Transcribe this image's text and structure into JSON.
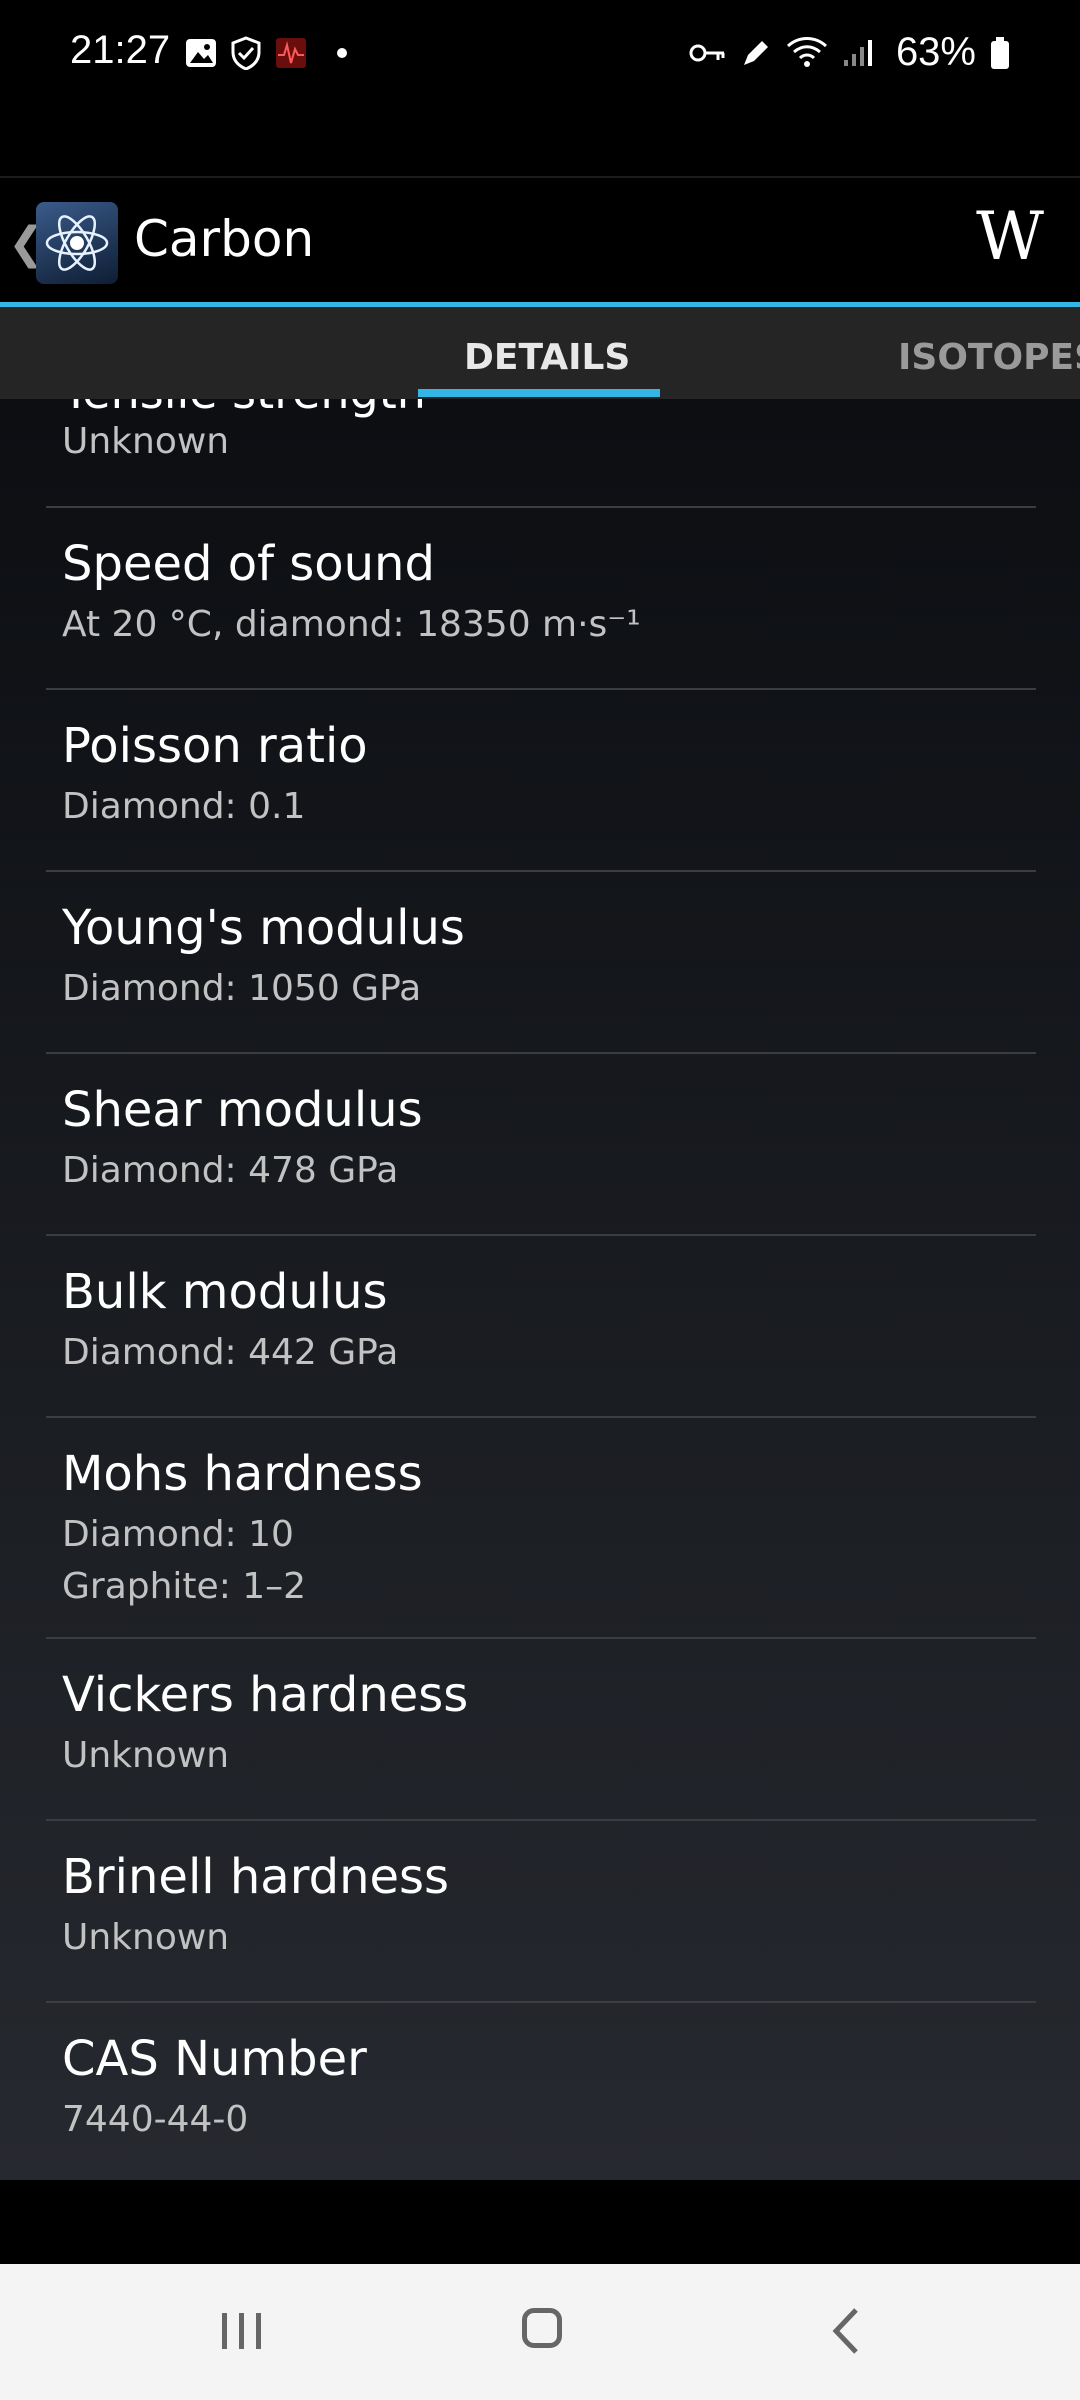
{
  "status_bar": {
    "time": "21:27",
    "battery": "63%",
    "icons_left": [
      "gallery-icon",
      "shield-icon",
      "pulse-icon",
      "notification-dot"
    ],
    "icons_right": [
      "vpn-key-icon",
      "pen-icon",
      "wifi-icon",
      "signal-icon",
      "battery-icon"
    ]
  },
  "action_bar": {
    "back": "❮",
    "title": "Carbon",
    "wiki": "W"
  },
  "tabs": [
    {
      "label": "DETAILS",
      "selected": true
    },
    {
      "label": "ISOTOPES",
      "selected": false
    }
  ],
  "accent_color": "#33b5e5",
  "partial_item": {
    "title": "Tensile strength",
    "value": "Unknown"
  },
  "items": [
    {
      "title": "Speed of sound",
      "value": "At 20 °C, diamond: 18350 m·s⁻¹"
    },
    {
      "title": "Poisson ratio",
      "value": "Diamond: 0.1"
    },
    {
      "title": "Young's modulus",
      "value": "Diamond: 1050 GPa"
    },
    {
      "title": "Shear modulus",
      "value": "Diamond: 478 GPa"
    },
    {
      "title": "Bulk modulus",
      "value": "Diamond: 442 GPa"
    },
    {
      "title": "Mohs hardness",
      "value": "Diamond: 10",
      "value2": "Graphite: 1–2"
    },
    {
      "title": "Vickers hardness",
      "value": "Unknown"
    },
    {
      "title": "Brinell hardness",
      "value": "Unknown"
    },
    {
      "title": "CAS Number",
      "value": "7440-44-0"
    }
  ],
  "nav_bar": {
    "buttons": [
      "recent-apps-icon",
      "home-icon",
      "back-icon"
    ]
  }
}
